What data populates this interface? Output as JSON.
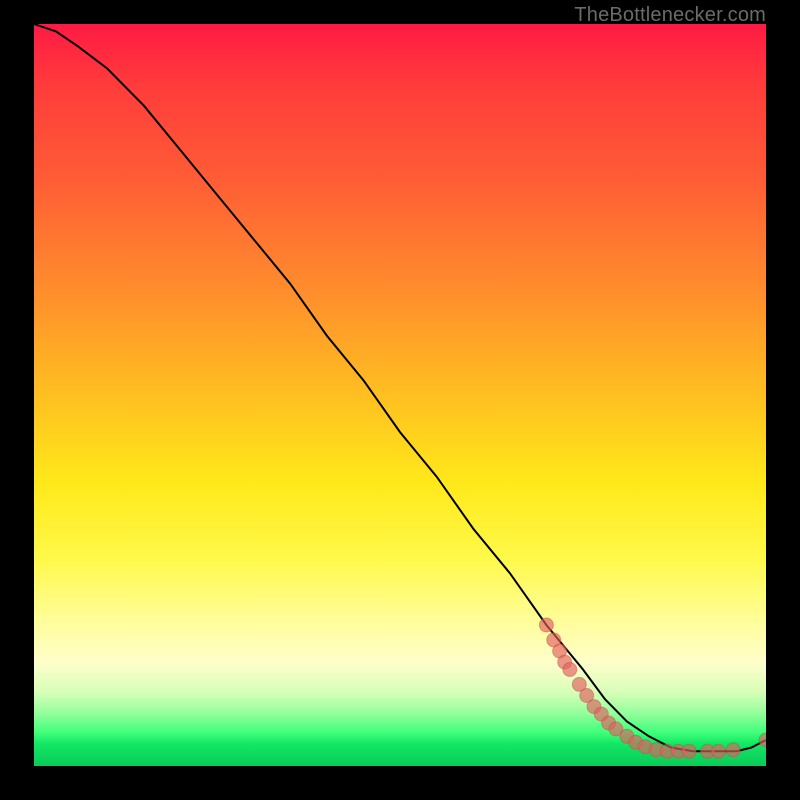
{
  "attribution": "TheBottlenecker.com",
  "colors": {
    "gradient_top": "#ff1a44",
    "gradient_bottom": "#0acb58",
    "curve": "#000000",
    "marker_fill": "#e06060",
    "marker_stroke": "#c84a4a",
    "background": "#000000"
  },
  "chart_data": {
    "type": "line",
    "title": "",
    "xlabel": "",
    "ylabel": "",
    "xlim": [
      0,
      100
    ],
    "ylim": [
      0,
      100
    ],
    "grid": false,
    "series": [
      {
        "name": "bottleneck-curve",
        "x": [
          0,
          3,
          6,
          10,
          15,
          20,
          25,
          30,
          35,
          40,
          45,
          50,
          55,
          60,
          65,
          70,
          75,
          78,
          81,
          84,
          87,
          90,
          93,
          96,
          98,
          100
        ],
        "y": [
          100,
          99,
          97,
          94,
          89,
          83,
          77,
          71,
          65,
          58,
          52,
          45,
          39,
          32,
          26,
          19,
          13,
          9,
          6,
          4,
          2.5,
          2,
          2,
          2,
          2.5,
          3.5
        ]
      }
    ],
    "markers": {
      "name": "highlighted-points",
      "points": [
        {
          "x": 70.0,
          "y": 19.0
        },
        {
          "x": 71.0,
          "y": 17.0
        },
        {
          "x": 71.8,
          "y": 15.5
        },
        {
          "x": 72.5,
          "y": 14.0
        },
        {
          "x": 73.2,
          "y": 13.0
        },
        {
          "x": 74.5,
          "y": 11.0
        },
        {
          "x": 75.5,
          "y": 9.5
        },
        {
          "x": 76.5,
          "y": 8.0
        },
        {
          "x": 77.5,
          "y": 7.0
        },
        {
          "x": 78.5,
          "y": 5.8
        },
        {
          "x": 79.5,
          "y": 5.0
        },
        {
          "x": 81.0,
          "y": 4.0
        },
        {
          "x": 82.2,
          "y": 3.2
        },
        {
          "x": 83.5,
          "y": 2.6
        },
        {
          "x": 85.0,
          "y": 2.2
        },
        {
          "x": 86.5,
          "y": 2.0
        },
        {
          "x": 88.0,
          "y": 2.0
        },
        {
          "x": 89.5,
          "y": 2.0
        },
        {
          "x": 92.0,
          "y": 2.0
        },
        {
          "x": 93.5,
          "y": 2.0
        },
        {
          "x": 95.5,
          "y": 2.2
        },
        {
          "x": 100.0,
          "y": 3.5
        }
      ],
      "radius": 7
    }
  }
}
